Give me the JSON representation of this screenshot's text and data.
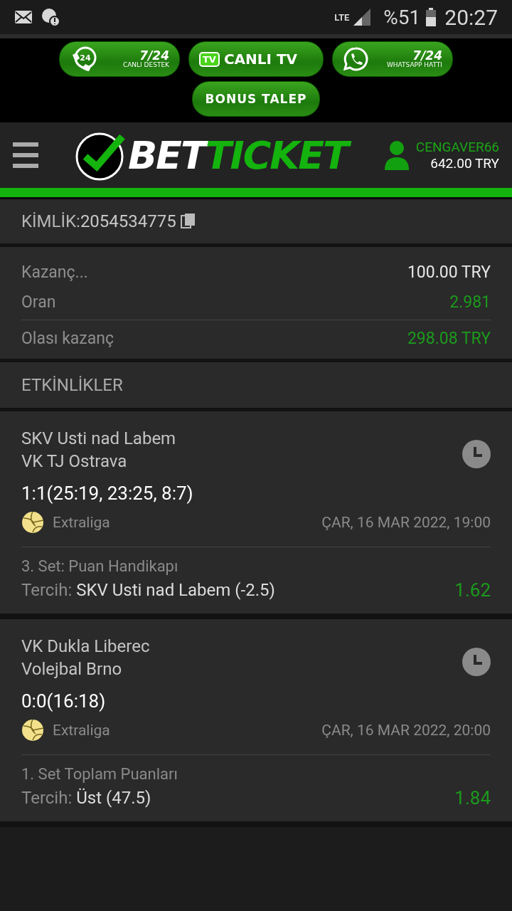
{
  "status_bar": {
    "network": "LTE",
    "battery": "%51",
    "time": "20:27"
  },
  "promo_buttons": [
    {
      "kind": "support",
      "badge": "24",
      "top": "7/24",
      "bottom": "CANLI DESTEK"
    },
    {
      "kind": "tv",
      "badge": "TV",
      "label": "CANLI TV"
    },
    {
      "kind": "whatsapp",
      "top": "7/24",
      "bottom": "WHATSAPP HATTI"
    },
    {
      "kind": "bonus",
      "label": "BONUS TALEP"
    }
  ],
  "header": {
    "logo_first": "BET",
    "logo_second": "TICKET",
    "username": "CENGAVER66",
    "balance": "642.00 TRY"
  },
  "ticket_id": {
    "label": "KİMLİK:",
    "value": "2054534775"
  },
  "summary": [
    {
      "label": "Kazanç...",
      "value": "100.00 TRY",
      "highlight": false
    },
    {
      "label": "Oran",
      "value": "2.981",
      "highlight": true
    },
    {
      "label": "Olası kazanç",
      "value": "298.08 TRY",
      "highlight": true
    }
  ],
  "events_title": "ETKİNLİKLER",
  "events": [
    {
      "teams": [
        "SKV Usti nad Labem",
        "VK TJ Ostrava"
      ],
      "score": "1:1(25:19, 23:25, 8:7)",
      "league": "Extraliga",
      "datetime": "ÇAR, 16 MAR 2022, 19:00",
      "market": "3. Set: Puan Handikapı",
      "choice_label": "Tercih:",
      "choice": "SKV Usti nad Labem (-2.5)",
      "odds": "1.62"
    },
    {
      "teams": [
        "VK Dukla Liberec",
        "Volejbal Brno"
      ],
      "score": "0:0(16:18)",
      "league": "Extraliga",
      "datetime": "ÇAR, 16 MAR 2022, 20:00",
      "market": "1. Set Toplam Puanları",
      "choice_label": "Tercih:",
      "choice": "Üst (47.5)",
      "odds": "1.84"
    }
  ]
}
